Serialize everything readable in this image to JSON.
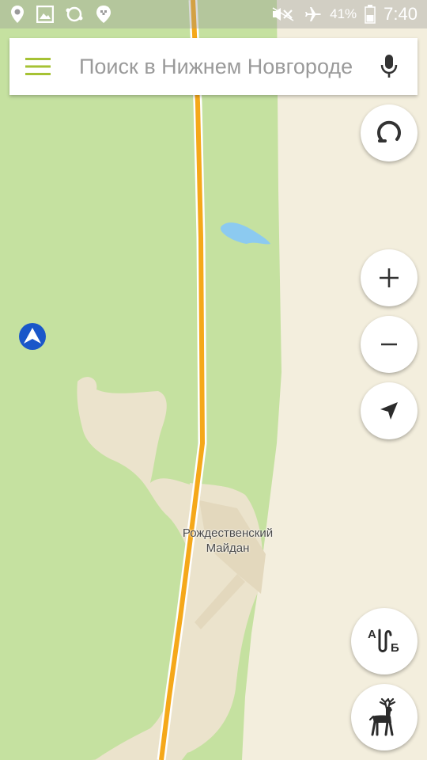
{
  "status_bar": {
    "battery_percent": "41%",
    "time": "7:40",
    "left_icons": [
      "location-pin-icon",
      "image-icon",
      "sync-icon",
      "taxi-pin-icon"
    ],
    "right_icons": [
      "mute-icon",
      "airplane-icon",
      "battery-icon"
    ]
  },
  "search": {
    "placeholder": "Поиск в Нижнем Новгороде",
    "value": ""
  },
  "map": {
    "place_label_line1": "Рождественский",
    "place_label_line2": "Майдан",
    "colors": {
      "forest": "#c5e1a0",
      "land": "#f3eedd",
      "settlement": "#ebe3cc",
      "road": "#f5a81a",
      "water": "#8ccaf0",
      "accent": "#a6c234",
      "location_marker": "#1a57c9"
    }
  },
  "controls": {
    "traffic": "traffic-icon",
    "zoom_in": "plus-icon",
    "zoom_out": "minus-icon",
    "my_location": "navigation-arrow-icon",
    "route": "route-ab-icon",
    "city_logo": "deer-icon"
  }
}
